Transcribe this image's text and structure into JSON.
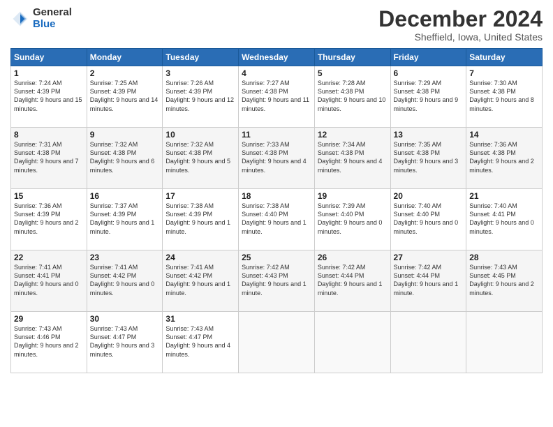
{
  "logo": {
    "general": "General",
    "blue": "Blue"
  },
  "title": "December 2024",
  "location": "Sheffield, Iowa, United States",
  "days_header": [
    "Sunday",
    "Monday",
    "Tuesday",
    "Wednesday",
    "Thursday",
    "Friday",
    "Saturday"
  ],
  "weeks": [
    [
      {
        "day": "1",
        "sunrise": "7:24 AM",
        "sunset": "4:39 PM",
        "daylight": "9 hours and 15 minutes."
      },
      {
        "day": "2",
        "sunrise": "7:25 AM",
        "sunset": "4:39 PM",
        "daylight": "9 hours and 14 minutes."
      },
      {
        "day": "3",
        "sunrise": "7:26 AM",
        "sunset": "4:39 PM",
        "daylight": "9 hours and 12 minutes."
      },
      {
        "day": "4",
        "sunrise": "7:27 AM",
        "sunset": "4:38 PM",
        "daylight": "9 hours and 11 minutes."
      },
      {
        "day": "5",
        "sunrise": "7:28 AM",
        "sunset": "4:38 PM",
        "daylight": "9 hours and 10 minutes."
      },
      {
        "day": "6",
        "sunrise": "7:29 AM",
        "sunset": "4:38 PM",
        "daylight": "9 hours and 9 minutes."
      },
      {
        "day": "7",
        "sunrise": "7:30 AM",
        "sunset": "4:38 PM",
        "daylight": "9 hours and 8 minutes."
      }
    ],
    [
      {
        "day": "8",
        "sunrise": "7:31 AM",
        "sunset": "4:38 PM",
        "daylight": "9 hours and 7 minutes."
      },
      {
        "day": "9",
        "sunrise": "7:32 AM",
        "sunset": "4:38 PM",
        "daylight": "9 hours and 6 minutes."
      },
      {
        "day": "10",
        "sunrise": "7:32 AM",
        "sunset": "4:38 PM",
        "daylight": "9 hours and 5 minutes."
      },
      {
        "day": "11",
        "sunrise": "7:33 AM",
        "sunset": "4:38 PM",
        "daylight": "9 hours and 4 minutes."
      },
      {
        "day": "12",
        "sunrise": "7:34 AM",
        "sunset": "4:38 PM",
        "daylight": "9 hours and 4 minutes."
      },
      {
        "day": "13",
        "sunrise": "7:35 AM",
        "sunset": "4:38 PM",
        "daylight": "9 hours and 3 minutes."
      },
      {
        "day": "14",
        "sunrise": "7:36 AM",
        "sunset": "4:38 PM",
        "daylight": "9 hours and 2 minutes."
      }
    ],
    [
      {
        "day": "15",
        "sunrise": "7:36 AM",
        "sunset": "4:39 PM",
        "daylight": "9 hours and 2 minutes."
      },
      {
        "day": "16",
        "sunrise": "7:37 AM",
        "sunset": "4:39 PM",
        "daylight": "9 hours and 1 minute."
      },
      {
        "day": "17",
        "sunrise": "7:38 AM",
        "sunset": "4:39 PM",
        "daylight": "9 hours and 1 minute."
      },
      {
        "day": "18",
        "sunrise": "7:38 AM",
        "sunset": "4:40 PM",
        "daylight": "9 hours and 1 minute."
      },
      {
        "day": "19",
        "sunrise": "7:39 AM",
        "sunset": "4:40 PM",
        "daylight": "9 hours and 0 minutes."
      },
      {
        "day": "20",
        "sunrise": "7:40 AM",
        "sunset": "4:40 PM",
        "daylight": "9 hours and 0 minutes."
      },
      {
        "day": "21",
        "sunrise": "7:40 AM",
        "sunset": "4:41 PM",
        "daylight": "9 hours and 0 minutes."
      }
    ],
    [
      {
        "day": "22",
        "sunrise": "7:41 AM",
        "sunset": "4:41 PM",
        "daylight": "9 hours and 0 minutes."
      },
      {
        "day": "23",
        "sunrise": "7:41 AM",
        "sunset": "4:42 PM",
        "daylight": "9 hours and 0 minutes."
      },
      {
        "day": "24",
        "sunrise": "7:41 AM",
        "sunset": "4:42 PM",
        "daylight": "9 hours and 1 minute."
      },
      {
        "day": "25",
        "sunrise": "7:42 AM",
        "sunset": "4:43 PM",
        "daylight": "9 hours and 1 minute."
      },
      {
        "day": "26",
        "sunrise": "7:42 AM",
        "sunset": "4:44 PM",
        "daylight": "9 hours and 1 minute."
      },
      {
        "day": "27",
        "sunrise": "7:42 AM",
        "sunset": "4:44 PM",
        "daylight": "9 hours and 1 minute."
      },
      {
        "day": "28",
        "sunrise": "7:43 AM",
        "sunset": "4:45 PM",
        "daylight": "9 hours and 2 minutes."
      }
    ],
    [
      {
        "day": "29",
        "sunrise": "7:43 AM",
        "sunset": "4:46 PM",
        "daylight": "9 hours and 2 minutes."
      },
      {
        "day": "30",
        "sunrise": "7:43 AM",
        "sunset": "4:47 PM",
        "daylight": "9 hours and 3 minutes."
      },
      {
        "day": "31",
        "sunrise": "7:43 AM",
        "sunset": "4:47 PM",
        "daylight": "9 hours and 4 minutes."
      },
      null,
      null,
      null,
      null
    ]
  ]
}
